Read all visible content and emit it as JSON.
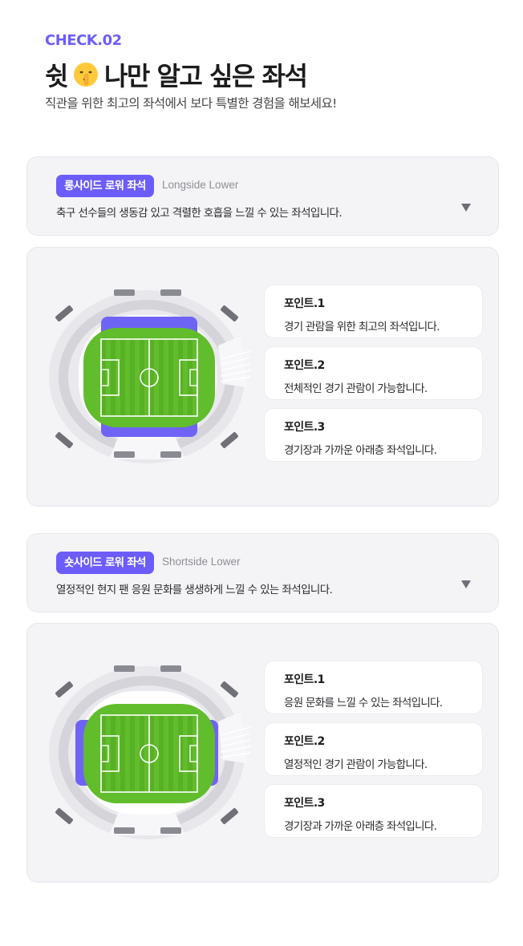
{
  "header": {
    "check": "CHECK.02",
    "title_part1": "쉿",
    "title_emoji": "shushing-face-icon",
    "title_part2": "나만 알고 싶은 좌석",
    "subtitle": "직관을 위한 최고의 좌석에서 보다 특별한 경험을 해보세요!"
  },
  "colors": {
    "accent": "#6c5dfa",
    "highlight": "#6f63f5",
    "pitch": "#61bd2c"
  },
  "sections": [
    {
      "badge": "롱사이드 로워 좌석",
      "en": "Longside Lower",
      "desc": "축구 선수들의 생동감 있고 격렬한 호흡을 느낄 수 있는 좌석입니다.",
      "highlight": "longside",
      "points": [
        {
          "label": "포인트.1",
          "text": "경기 관람을 위한 최고의 좌석입니다."
        },
        {
          "label": "포인트.2",
          "text": "전체적인 경기 관람이 가능합니다."
        },
        {
          "label": "포인트.3",
          "text": "경기장과 가까운 아래층 좌석입니다."
        }
      ]
    },
    {
      "badge": "숏사이드 로워 좌석",
      "en": "Shortside Lower",
      "desc": "열정적인 현지 팬 응원 문화를 생생하게 느낄 수 있는 좌석입니다.",
      "highlight": "shortside",
      "points": [
        {
          "label": "포인트.1",
          "text": "응원 문화를 느낄 수 있는 좌석입니다."
        },
        {
          "label": "포인트.2",
          "text": "열정적인 경기 관람이 가능합니다."
        },
        {
          "label": "포인트.3",
          "text": "경기장과 가까운 아래층 좌석입니다."
        }
      ]
    }
  ]
}
